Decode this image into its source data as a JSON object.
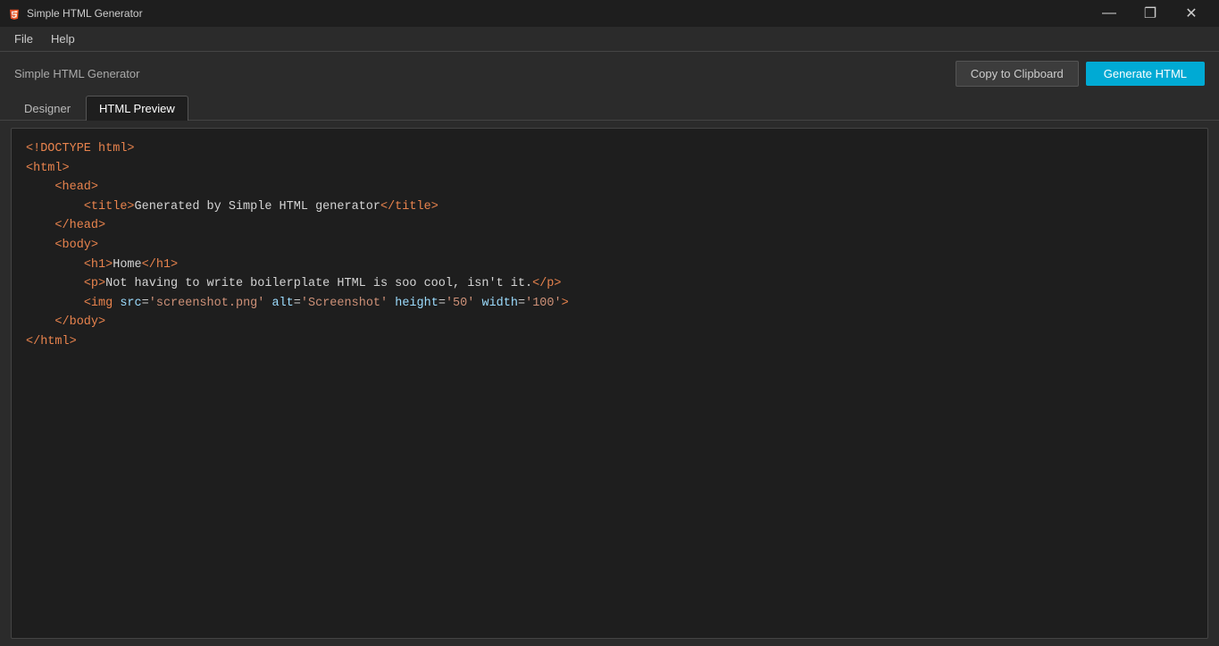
{
  "titlebar": {
    "icon": "html5",
    "title": "Simple HTML Generator",
    "minimize_label": "—",
    "maximize_label": "❐",
    "close_label": "✕"
  },
  "menubar": {
    "items": [
      {
        "label": "File"
      },
      {
        "label": "Help"
      }
    ]
  },
  "header": {
    "app_title": "Simple HTML Generator",
    "copy_button": "Copy to Clipboard",
    "generate_button": "Generate HTML"
  },
  "tabs": [
    {
      "id": "designer",
      "label": "Designer",
      "active": false
    },
    {
      "id": "html-preview",
      "label": "HTML Preview",
      "active": true
    }
  ],
  "code": {
    "line1": "<!DOCTYPE html>",
    "line2": "<html>",
    "line3": "    <head>",
    "line4": "        <title>Generated by Simple HTML generator</title>",
    "line5": "    </head>",
    "line6": "    <body>",
    "line7": "        <h1>Home</h1>",
    "line8": "        <p>Not having to write boilerplate HTML is soo cool, isn't it.</p>",
    "line9": "        <img src='screenshot.png' alt='Screenshot' height='50' width='100'>",
    "line10": "    </body>",
    "line11": "</html>"
  }
}
